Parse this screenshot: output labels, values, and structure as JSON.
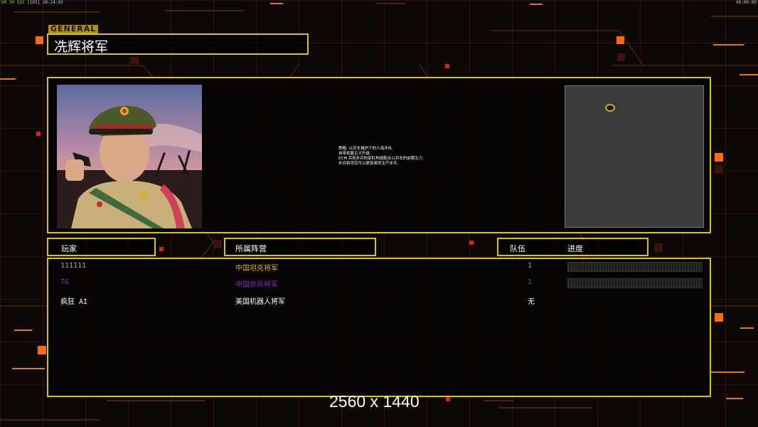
{
  "status_bar": {
    "left_green": "UR 30 SSS",
    "left_rest": "|165| 20:24:03",
    "right_clock": "00:00:00"
  },
  "header": {
    "tag": "GENERAL",
    "title": "冼辉将军"
  },
  "description": {
    "lines": [
      "策略: 以兵车掩护下的人海冲击.",
      "自带拓展主义升级.",
      "ECM 兵和步兵的部队构成配合以兵车的前期主力.",
      "步兵和坦克可以更容易的生产步兵."
    ]
  },
  "columns": {
    "player": "玩家",
    "faction": "所属阵营",
    "team": "队伍",
    "progress": "进度"
  },
  "players": [
    {
      "name": "111111",
      "faction": "中国坦克将军",
      "team": "1",
      "color": "#b7a18f",
      "faction_color": "#d8b31c",
      "show_progress": true
    },
    {
      "name": "TG",
      "faction": "中国步兵将军",
      "team": "1",
      "color": "#8a2bd0",
      "faction_color": "#8a2bd0",
      "show_progress": true
    },
    {
      "name": "疯狂 AI",
      "faction": "美国机器人将军",
      "team": "无",
      "color": "#ffffff",
      "faction_color": "#ffffff",
      "show_progress": false
    }
  ],
  "footer": {
    "resolution": "2560 x 1440"
  },
  "colors": {
    "accent_border": "#d8c21c",
    "tag_bg": "#b39009",
    "orange_glow": "#ff6a10"
  }
}
